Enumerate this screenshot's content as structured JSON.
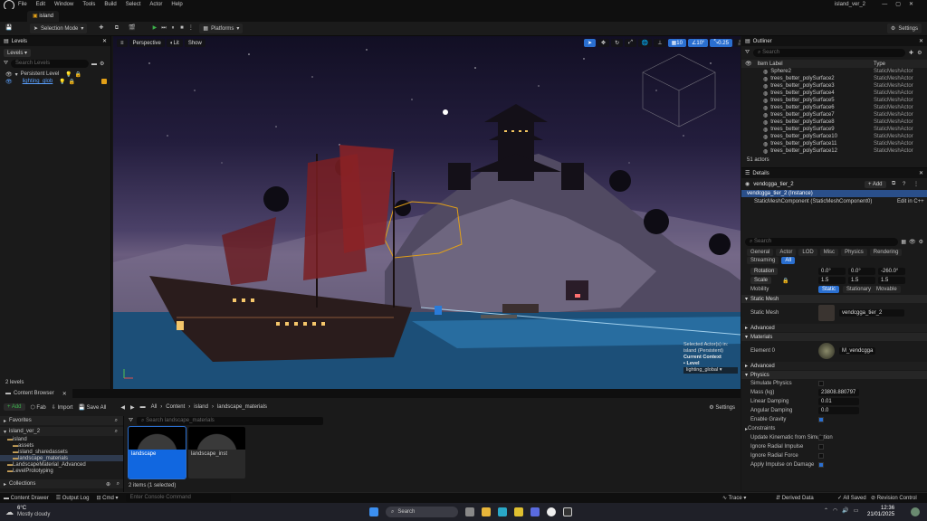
{
  "app": {
    "menus": [
      "File",
      "Edit",
      "Window",
      "Tools",
      "Build",
      "Select",
      "Actor",
      "Help"
    ],
    "project_name": "island_ver_2",
    "tab": "island"
  },
  "toolbar": {
    "selection_mode": "Selection Mode",
    "platforms": "Platforms",
    "settings": "Settings"
  },
  "levels_panel": {
    "title": "Levels",
    "levels_button": "Levels",
    "search_placeholder": "Search Levels",
    "rows": [
      "Persistent Level",
      "lighting_glob"
    ],
    "count": "2 levels"
  },
  "viewport": {
    "perspective": "Perspective",
    "lit": "Lit",
    "show": "Show",
    "grid_snap": "10",
    "rotation_snap": "10°",
    "scale_snap": "0.25",
    "camera_speed": "1",
    "selected_info": "Selected Actor(s) in: island (Persistent)",
    "current_context": "Current Context",
    "level_label": "Level",
    "level_value": "lighting_global"
  },
  "outliner": {
    "title": "Outliner",
    "search_placeholder": "Search",
    "col_label": "Item Label",
    "col_type": "Type",
    "rows": [
      {
        "label": "Sphere2",
        "type": "StaticMeshActor"
      },
      {
        "label": "trees_better_polySurface2",
        "type": "StaticMeshActor"
      },
      {
        "label": "trees_better_polySurface3",
        "type": "StaticMeshActor"
      },
      {
        "label": "trees_better_polySurface4",
        "type": "StaticMeshActor"
      },
      {
        "label": "trees_better_polySurface5",
        "type": "StaticMeshActor"
      },
      {
        "label": "trees_better_polySurface6",
        "type": "StaticMeshActor"
      },
      {
        "label": "trees_better_polySurface7",
        "type": "StaticMeshActor"
      },
      {
        "label": "trees_better_polySurface8",
        "type": "StaticMeshActor"
      },
      {
        "label": "trees_better_polySurface9",
        "type": "StaticMeshActor"
      },
      {
        "label": "trees_better_polySurface10",
        "type": "StaticMeshActor"
      },
      {
        "label": "trees_better_polySurface11",
        "type": "StaticMeshActor"
      },
      {
        "label": "trees_better_polySurface12",
        "type": "StaticMeshActor"
      }
    ],
    "count": "51 actors"
  },
  "details": {
    "title": "Details",
    "actor_name": "vendcgga_tier_2",
    "add_button": "+ Add",
    "instance": "vendcgga_tier_2 (Instance)",
    "component": "StaticMeshComponent (StaticMeshComponent0)",
    "edit_cpp": "Edit in C++",
    "search_placeholder": "Search",
    "tabs": [
      "General",
      "Actor",
      "LOD",
      "Misc",
      "Physics",
      "Rendering",
      "Streaming",
      "All"
    ],
    "rotation_label": "Rotation",
    "rotation_values": [
      "0.0°",
      "0.0°",
      "-260.0°"
    ],
    "scale_label": "Scale",
    "scale_values": [
      "1.5",
      "1.5",
      "1.5"
    ],
    "mobility_label": "Mobility",
    "mobility_options": [
      "Static",
      "Stationary",
      "Movable"
    ],
    "static_mesh_section": "Static Mesh",
    "static_mesh_label": "Static Mesh",
    "static_mesh_value": "vendcgga_tier_2",
    "advanced": "Advanced",
    "materials_section": "Materials",
    "element_label": "Element 0",
    "material_value": "M_vendcgga",
    "physics_section": "Physics",
    "physics_rows": [
      {
        "label": "Simulate Physics",
        "kind": "check",
        "value": ""
      },
      {
        "label": "Mass (kg)",
        "kind": "value",
        "value": "23808.880797"
      },
      {
        "label": "Linear Damping",
        "kind": "value",
        "value": "0.01"
      },
      {
        "label": "Angular Damping",
        "kind": "value",
        "value": "0.0"
      },
      {
        "label": "Enable Gravity",
        "kind": "checkon",
        "value": ""
      },
      {
        "label": "Constraints",
        "kind": "section",
        "value": ""
      },
      {
        "label": "Update Kinematic from Simulation",
        "kind": "check",
        "value": ""
      },
      {
        "label": "Ignore Radial Impulse",
        "kind": "check",
        "value": ""
      },
      {
        "label": "Ignore Radial Force",
        "kind": "check",
        "value": ""
      },
      {
        "label": "Apply Impulse on Damage",
        "kind": "checkon",
        "value": ""
      }
    ]
  },
  "content_browser": {
    "tab_title": "Content Browser",
    "add": "+ Add",
    "fab": "Fab",
    "import": "Import",
    "save_all": "Save All",
    "breadcrumb": [
      "All",
      "Content",
      "island",
      "landscape_materials"
    ],
    "settings": "Settings",
    "search_placeholder": "Search landscape_materials",
    "favorites": "Favorites",
    "project": "island_ver_2",
    "tree": [
      "island",
      "assets",
      "island_sharedassets",
      "landscape_materials",
      "LandscapeMaterial_Advanced",
      "LevelPrototyping"
    ],
    "collections": "Collections",
    "tiles": [
      "landscape",
      "landscape_inst"
    ],
    "count": "2 items (1 selected)"
  },
  "statusbar": {
    "content_drawer": "Content Drawer",
    "output_log": "Output Log",
    "cmd": "Cmd",
    "console_placeholder": "Enter Console Command",
    "trace": "Trace",
    "derived_data": "Derived Data",
    "all_saved": "All Saved",
    "revision_control": "Revision Control"
  },
  "taskbar": {
    "weather_temp": "6°C",
    "weather_desc": "Mostly cloudy",
    "search": "Search",
    "time": "12:36",
    "date": "21/01/2025"
  },
  "colors": {
    "accent": "#2a6fd0",
    "panel": "#1a1a1a",
    "play_green": "#3bb04a",
    "material_highlight": "#e3a017"
  }
}
